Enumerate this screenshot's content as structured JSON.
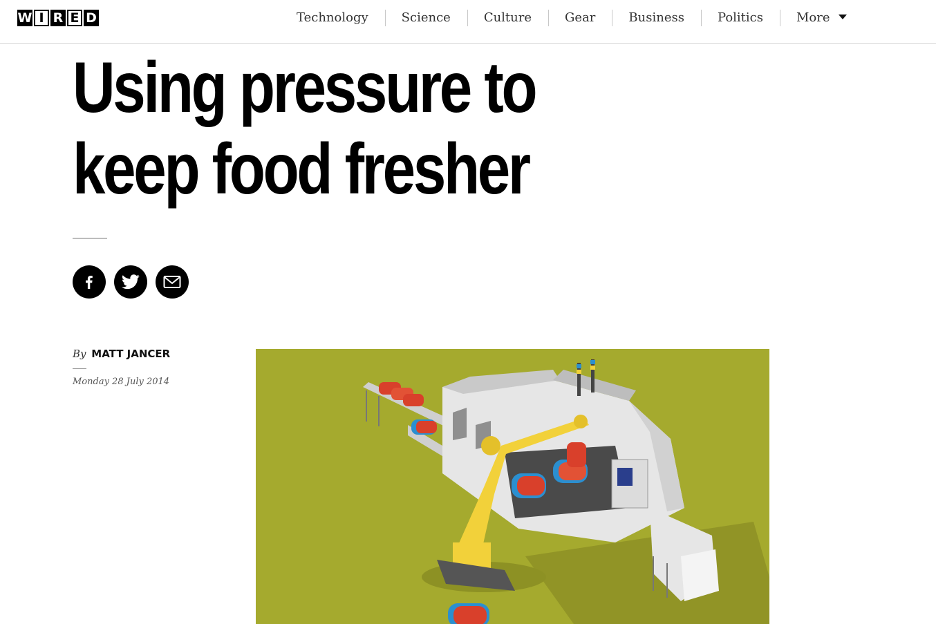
{
  "logo": {
    "letters": [
      "W",
      "I",
      "R",
      "E",
      "D"
    ],
    "alt": "WIRED"
  },
  "nav": {
    "items": [
      "Technology",
      "Science",
      "Culture",
      "Gear",
      "Business",
      "Politics"
    ],
    "more_label": "More"
  },
  "article": {
    "title": "Using pressure to keep food fresher",
    "by_prefix": "By",
    "author": "MATT JANCER",
    "date": "Monday 28 July 2014"
  },
  "social": [
    "facebook-icon",
    "twitter-icon",
    "email-icon"
  ],
  "colors": {
    "hero_background": "#a5aa2e",
    "machine_steel": "#d9d9d9",
    "robot_arm": "#f2d13a",
    "food_red": "#d9402b",
    "tray_blue": "#2b8fd0"
  }
}
